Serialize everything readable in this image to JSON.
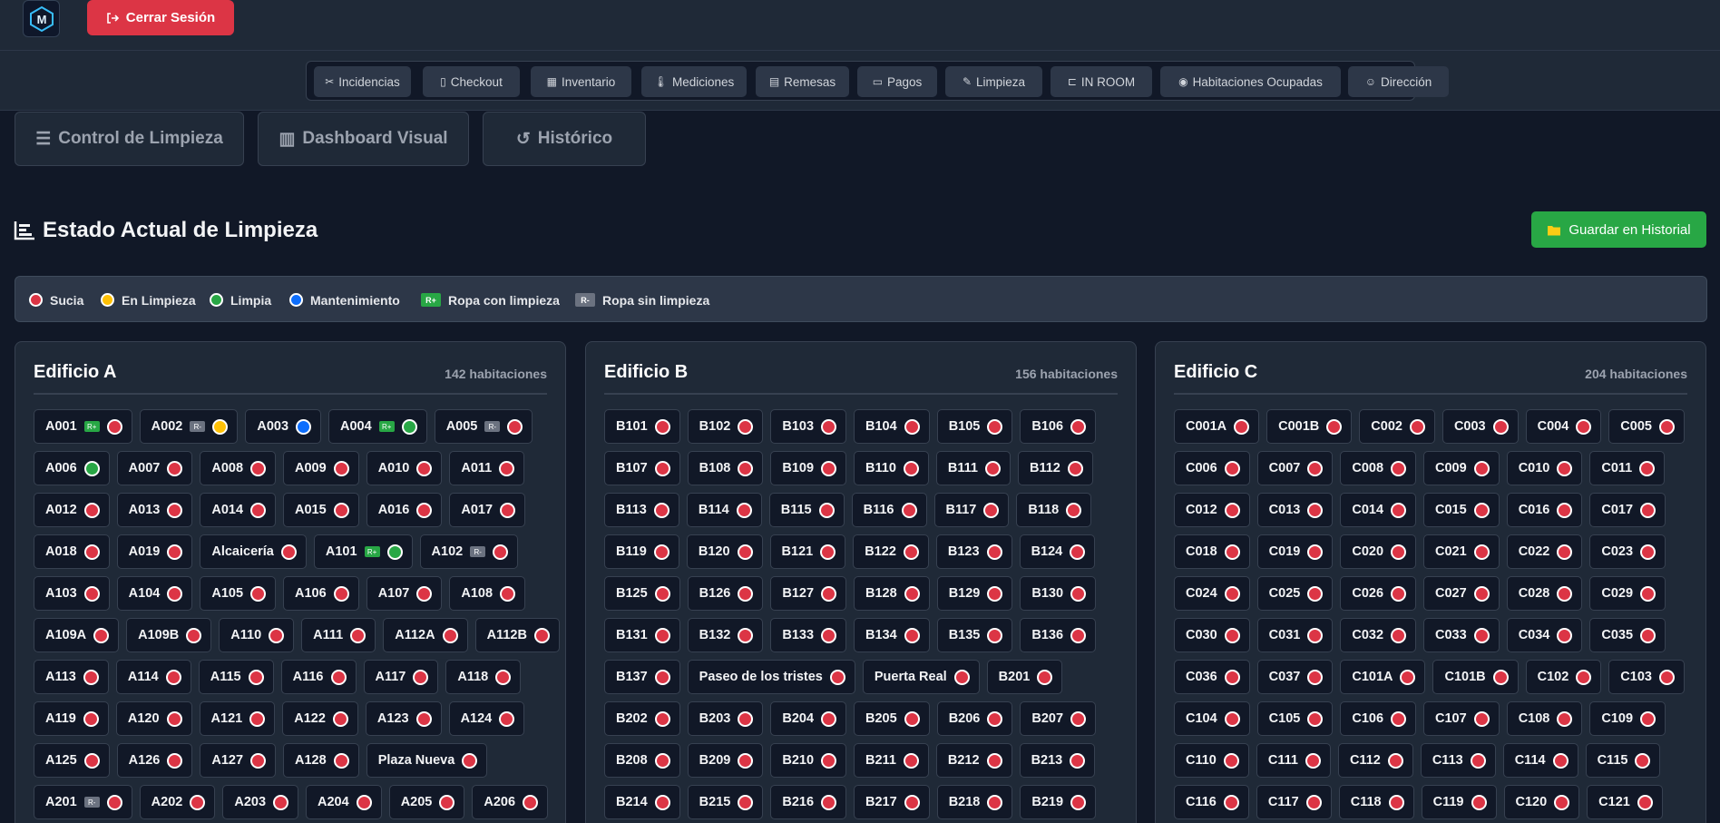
{
  "header": {
    "logout_label": "Cerrar Sesión",
    "logo_letter": "M"
  },
  "nav": [
    {
      "label": "Incidencias",
      "icon": "tools-icon"
    },
    {
      "label": "Checkout",
      "icon": "door-icon"
    },
    {
      "label": "Inventario",
      "icon": "boxes-icon"
    },
    {
      "label": "Mediciones",
      "icon": "thermometer-icon"
    },
    {
      "label": "Remesas",
      "icon": "invoice-icon"
    },
    {
      "label": "Pagos",
      "icon": "credit-card-icon"
    },
    {
      "label": "Limpieza",
      "icon": "broom-icon"
    },
    {
      "label": "IN ROOM",
      "icon": "bed-icon"
    },
    {
      "label": "Habitaciones Ocupadas",
      "icon": "eye-icon"
    },
    {
      "label": "Dirección",
      "icon": "user-gear-icon"
    }
  ],
  "tabs": [
    {
      "label": "Control de Limpieza",
      "icon": "list-check-icon"
    },
    {
      "label": "Dashboard Visual",
      "icon": "chart-icon"
    },
    {
      "label": "Histórico",
      "icon": "history-icon"
    }
  ],
  "section": {
    "title": "Estado Actual de Limpieza",
    "save_label": "Guardar en Historial"
  },
  "legend": [
    {
      "label": "Sucia",
      "kind": "dot",
      "color": "#dc3545"
    },
    {
      "label": "En Limpieza",
      "kind": "dot",
      "color": "#ffc107"
    },
    {
      "label": "Limpia",
      "kind": "dot",
      "color": "#28a745"
    },
    {
      "label": "Mantenimiento",
      "kind": "dot",
      "color": "#0d6efd"
    },
    {
      "label": "Ropa con limpieza",
      "kind": "badge",
      "badge": "R+",
      "color": "#28a745"
    },
    {
      "label": "Ropa sin limpieza",
      "kind": "badge",
      "badge": "R-",
      "color": "#6b7280"
    }
  ],
  "buildings": [
    {
      "title": "Edificio A",
      "count": "142 habitaciones",
      "rows": [
        [
          [
            "A001",
            "limpieza-ropa+sucia"
          ],
          [
            "A002",
            "ropa-limpieza"
          ],
          [
            "A003",
            "mant"
          ],
          [
            "A004",
            "ropa+limpia"
          ],
          [
            "A005",
            "ropa-sucia"
          ]
        ],
        [
          [
            "A006",
            "limpia"
          ],
          [
            "A007",
            "sucia"
          ],
          [
            "A008",
            "sucia"
          ],
          [
            "A009",
            "sucia"
          ],
          [
            "A010",
            "sucia"
          ],
          [
            "A011",
            "sucia"
          ]
        ],
        [
          [
            "A012",
            "sucia"
          ],
          [
            "A013",
            "sucia"
          ],
          [
            "A014",
            "sucia"
          ],
          [
            "A015",
            "sucia"
          ],
          [
            "A016",
            "sucia"
          ],
          [
            "A017",
            "sucia"
          ]
        ],
        [
          [
            "A018",
            "sucia"
          ],
          [
            "A019",
            "sucia"
          ],
          [
            "Alcaicería",
            "sucia"
          ],
          [
            "A101",
            "ropa+limpia"
          ],
          [
            "A102",
            "ropa-sucia"
          ]
        ],
        [
          [
            "A103",
            "sucia"
          ],
          [
            "A104",
            "sucia"
          ],
          [
            "A105",
            "sucia"
          ],
          [
            "A106",
            "sucia"
          ],
          [
            "A107",
            "sucia"
          ],
          [
            "A108",
            "sucia"
          ]
        ],
        [
          [
            "A109A",
            "sucia"
          ],
          [
            "A109B",
            "sucia"
          ],
          [
            "A110",
            "sucia"
          ],
          [
            "A111",
            "sucia"
          ],
          [
            "A112A",
            "sucia"
          ],
          [
            "A112B",
            "sucia"
          ]
        ],
        [
          [
            "A113",
            "sucia"
          ],
          [
            "A114",
            "sucia"
          ],
          [
            "A115",
            "sucia"
          ],
          [
            "A116",
            "sucia"
          ],
          [
            "A117",
            "sucia"
          ],
          [
            "A118",
            "sucia"
          ]
        ],
        [
          [
            "A119",
            "sucia"
          ],
          [
            "A120",
            "sucia"
          ],
          [
            "A121",
            "sucia"
          ],
          [
            "A122",
            "sucia"
          ],
          [
            "A123",
            "sucia"
          ],
          [
            "A124",
            "sucia"
          ]
        ],
        [
          [
            "A125",
            "sucia"
          ],
          [
            "A126",
            "sucia"
          ],
          [
            "A127",
            "sucia"
          ],
          [
            "A128",
            "sucia"
          ],
          [
            "Plaza Nueva",
            "sucia"
          ]
        ],
        [
          [
            "A201",
            "ropa-sucia"
          ],
          [
            "A202",
            "sucia"
          ],
          [
            "A203",
            "sucia"
          ],
          [
            "A204",
            "sucia"
          ],
          [
            "A205",
            "sucia"
          ],
          [
            "A206",
            "sucia"
          ]
        ]
      ]
    },
    {
      "title": "Edificio B",
      "count": "156 habitaciones",
      "rows": [
        [
          [
            "B101",
            "sucia"
          ],
          [
            "B102",
            "sucia"
          ],
          [
            "B103",
            "sucia"
          ],
          [
            "B104",
            "sucia"
          ],
          [
            "B105",
            "sucia"
          ],
          [
            "B106",
            "sucia"
          ]
        ],
        [
          [
            "B107",
            "sucia"
          ],
          [
            "B108",
            "sucia"
          ],
          [
            "B109",
            "sucia"
          ],
          [
            "B110",
            "sucia"
          ],
          [
            "B111",
            "sucia"
          ],
          [
            "B112",
            "sucia"
          ]
        ],
        [
          [
            "B113",
            "sucia"
          ],
          [
            "B114",
            "sucia"
          ],
          [
            "B115",
            "sucia"
          ],
          [
            "B116",
            "sucia"
          ],
          [
            "B117",
            "sucia"
          ],
          [
            "B118",
            "sucia"
          ]
        ],
        [
          [
            "B119",
            "sucia"
          ],
          [
            "B120",
            "sucia"
          ],
          [
            "B121",
            "sucia"
          ],
          [
            "B122",
            "sucia"
          ],
          [
            "B123",
            "sucia"
          ],
          [
            "B124",
            "sucia"
          ]
        ],
        [
          [
            "B125",
            "sucia"
          ],
          [
            "B126",
            "sucia"
          ],
          [
            "B127",
            "sucia"
          ],
          [
            "B128",
            "sucia"
          ],
          [
            "B129",
            "sucia"
          ],
          [
            "B130",
            "sucia"
          ]
        ],
        [
          [
            "B131",
            "sucia"
          ],
          [
            "B132",
            "sucia"
          ],
          [
            "B133",
            "sucia"
          ],
          [
            "B134",
            "sucia"
          ],
          [
            "B135",
            "sucia"
          ],
          [
            "B136",
            "sucia"
          ]
        ],
        [
          [
            "B137",
            "sucia"
          ],
          [
            "Paseo de los tristes",
            "sucia"
          ],
          [
            "Puerta Real",
            "sucia"
          ],
          [
            "B201",
            "sucia"
          ]
        ],
        [
          [
            "B202",
            "sucia"
          ],
          [
            "B203",
            "sucia"
          ],
          [
            "B204",
            "sucia"
          ],
          [
            "B205",
            "sucia"
          ],
          [
            "B206",
            "sucia"
          ],
          [
            "B207",
            "sucia"
          ]
        ],
        [
          [
            "B208",
            "sucia"
          ],
          [
            "B209",
            "sucia"
          ],
          [
            "B210",
            "sucia"
          ],
          [
            "B211",
            "sucia"
          ],
          [
            "B212",
            "sucia"
          ],
          [
            "B213",
            "sucia"
          ]
        ],
        [
          [
            "B214",
            "sucia"
          ],
          [
            "B215",
            "sucia"
          ],
          [
            "B216",
            "sucia"
          ],
          [
            "B217",
            "sucia"
          ],
          [
            "B218",
            "sucia"
          ],
          [
            "B219",
            "sucia"
          ]
        ]
      ]
    },
    {
      "title": "Edificio C",
      "count": "204 habitaciones",
      "rows": [
        [
          [
            "C001A",
            "sucia"
          ],
          [
            "C001B",
            "sucia"
          ],
          [
            "C002",
            "sucia"
          ],
          [
            "C003",
            "sucia"
          ],
          [
            "C004",
            "sucia"
          ],
          [
            "C005",
            "sucia"
          ]
        ],
        [
          [
            "C006",
            "sucia"
          ],
          [
            "C007",
            "sucia"
          ],
          [
            "C008",
            "sucia"
          ],
          [
            "C009",
            "sucia"
          ],
          [
            "C010",
            "sucia"
          ],
          [
            "C011",
            "sucia"
          ]
        ],
        [
          [
            "C012",
            "sucia"
          ],
          [
            "C013",
            "sucia"
          ],
          [
            "C014",
            "sucia"
          ],
          [
            "C015",
            "sucia"
          ],
          [
            "C016",
            "sucia"
          ],
          [
            "C017",
            "sucia"
          ]
        ],
        [
          [
            "C018",
            "sucia"
          ],
          [
            "C019",
            "sucia"
          ],
          [
            "C020",
            "sucia"
          ],
          [
            "C021",
            "sucia"
          ],
          [
            "C022",
            "sucia"
          ],
          [
            "C023",
            "sucia"
          ]
        ],
        [
          [
            "C024",
            "sucia"
          ],
          [
            "C025",
            "sucia"
          ],
          [
            "C026",
            "sucia"
          ],
          [
            "C027",
            "sucia"
          ],
          [
            "C028",
            "sucia"
          ],
          [
            "C029",
            "sucia"
          ]
        ],
        [
          [
            "C030",
            "sucia"
          ],
          [
            "C031",
            "sucia"
          ],
          [
            "C032",
            "sucia"
          ],
          [
            "C033",
            "sucia"
          ],
          [
            "C034",
            "sucia"
          ],
          [
            "C035",
            "sucia"
          ]
        ],
        [
          [
            "C036",
            "sucia"
          ],
          [
            "C037",
            "sucia"
          ],
          [
            "C101A",
            "sucia"
          ],
          [
            "C101B",
            "sucia"
          ],
          [
            "C102",
            "sucia"
          ],
          [
            "C103",
            "sucia"
          ]
        ],
        [
          [
            "C104",
            "sucia"
          ],
          [
            "C105",
            "sucia"
          ],
          [
            "C106",
            "sucia"
          ],
          [
            "C107",
            "sucia"
          ],
          [
            "C108",
            "sucia"
          ],
          [
            "C109",
            "sucia"
          ]
        ],
        [
          [
            "C110",
            "sucia"
          ],
          [
            "C111",
            "sucia"
          ],
          [
            "C112",
            "sucia"
          ],
          [
            "C113",
            "sucia"
          ],
          [
            "C114",
            "sucia"
          ],
          [
            "C115",
            "sucia"
          ]
        ],
        [
          [
            "C116",
            "sucia"
          ],
          [
            "C117",
            "sucia"
          ],
          [
            "C118",
            "sucia"
          ],
          [
            "C119",
            "sucia"
          ],
          [
            "C120",
            "sucia"
          ],
          [
            "C121",
            "sucia"
          ]
        ]
      ]
    }
  ]
}
